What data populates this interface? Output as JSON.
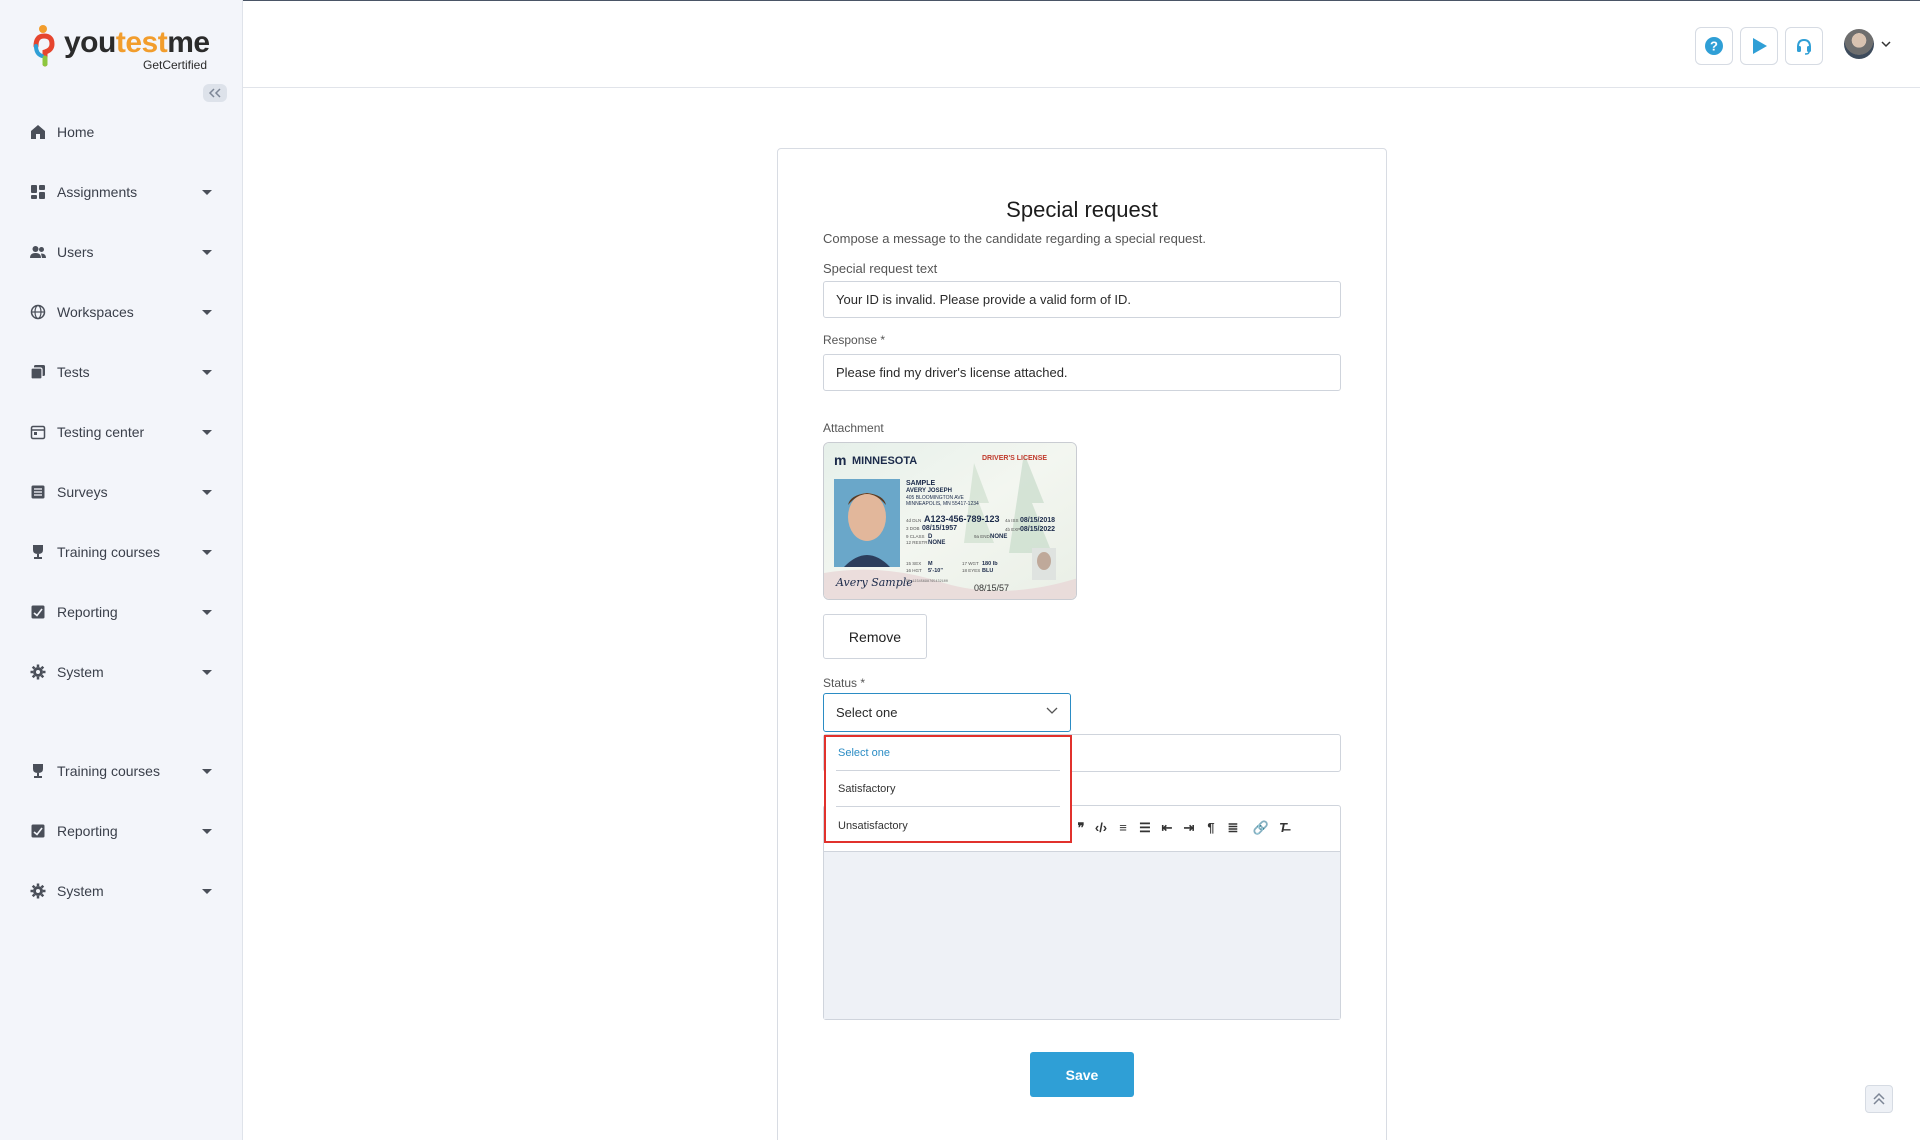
{
  "brand": {
    "name_part1": "you",
    "name_part2": "test",
    "name_part3": "me",
    "tagline": "GetCertified",
    "accent": "#2f9fd6"
  },
  "sidebar": {
    "collapse_icon": "double-chevron-left",
    "items": [
      {
        "label": "Home",
        "icon": "home-icon",
        "caret": false
      },
      {
        "label": "Assignments",
        "icon": "dashboard-icon",
        "caret": true
      },
      {
        "label": "Users",
        "icon": "users-icon",
        "caret": true
      },
      {
        "label": "Workspaces",
        "icon": "globe-icon",
        "caret": true
      },
      {
        "label": "Tests",
        "icon": "tests-icon",
        "caret": true
      },
      {
        "label": "Testing center",
        "icon": "calendar-icon",
        "caret": true
      },
      {
        "label": "Surveys",
        "icon": "list-icon",
        "caret": true
      },
      {
        "label": "Training courses",
        "icon": "trophy-icon",
        "caret": true
      },
      {
        "label": "Reporting",
        "icon": "report-icon",
        "caret": true
      },
      {
        "label": "System",
        "icon": "gear-icon",
        "caret": true
      },
      {
        "label": "Training courses",
        "icon": "trophy-icon",
        "caret": true
      },
      {
        "label": "Reporting",
        "icon": "report-icon",
        "caret": true
      },
      {
        "label": "System",
        "icon": "gear-icon",
        "caret": true
      }
    ]
  },
  "header": {
    "buttons": [
      "help-icon",
      "play-icon",
      "headset-icon"
    ]
  },
  "form": {
    "title": "Special request",
    "description": "Compose a message to the candidate regarding a special request.",
    "special_request_label": "Special request text",
    "special_request_value": "Your ID is invalid. Please provide a valid form of ID.",
    "response_label": "Response *",
    "response_value": "Please find my driver's license attached.",
    "attachment_label": "Attachment",
    "license": {
      "state": "MINNESOTA",
      "type": "DRIVER'S LICENSE",
      "line1": "SAMPLE",
      "line2": "AVERY JOSEPH",
      "line3": "405 BLOOMINGTON AVE",
      "line4": "MINNEAPOLIS, MN 55417-1234",
      "dl_prefix": "4d DLN",
      "dl_number": "A123-456-789-123",
      "dob_label": "3 DOB",
      "dob": "08/15/1957",
      "iss_label": "4a ISS",
      "iss": "08/15/2018",
      "exp_label": "4b EXP",
      "exp": "08/15/2022",
      "class_label": "9 CLASS",
      "class_value": "D",
      "end_label": "9a END",
      "end_value": "NONE",
      "rest_label": "12 RESTR",
      "rest_value": "NONE",
      "sex_label": "15 SEX",
      "sex_value": "M",
      "hgt_label": "16 HGT",
      "hgt_value": "5'-10\"",
      "wgt_label": "17 WGT",
      "wgt_value": "180 lb",
      "eyes_label": "18 EYES",
      "eyes_value": "BLU",
      "signature": "Avery Sample",
      "bottom_date": "08/15/57",
      "doc_number": "DD 12345698765432100"
    },
    "remove_label": "Remove",
    "status_label": "Status *",
    "status_value": "Select one",
    "status_options": [
      "Select one",
      "Satisfactory",
      "Unsatisfactory"
    ],
    "save_label": "Save"
  }
}
